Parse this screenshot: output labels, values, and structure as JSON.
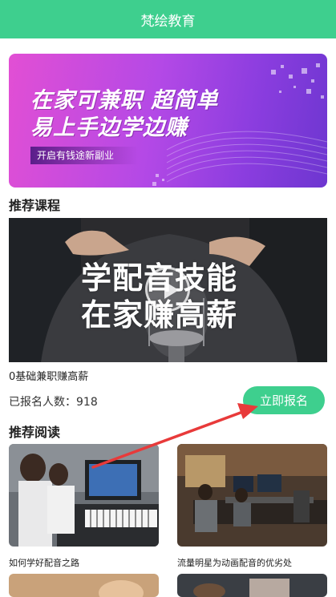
{
  "header": {
    "title": "梵绘教育"
  },
  "banner": {
    "line1": "在家可兼职  超简单",
    "line2": "易上手边学边赚",
    "subtitle": "开启有钱途新副业",
    "accent_color": "#c84fe6"
  },
  "recommended_courses": {
    "section_title": "推荐课程",
    "course": {
      "overlay_line1": "学配音技能",
      "overlay_line2": "在家赚高薪",
      "name": "0基础兼职赚高薪",
      "enroll_label": "已报名人数：",
      "enroll_count": "918",
      "enroll_button": "立即报名"
    }
  },
  "recommended_reading": {
    "section_title": "推荐阅读",
    "articles": [
      {
        "title": "如何学好配音之路"
      },
      {
        "title": "流量明星为动画配音的优劣处"
      }
    ]
  },
  "colors": {
    "primary": "#3ecf8e",
    "annotation_arrow": "#e83a3a"
  }
}
